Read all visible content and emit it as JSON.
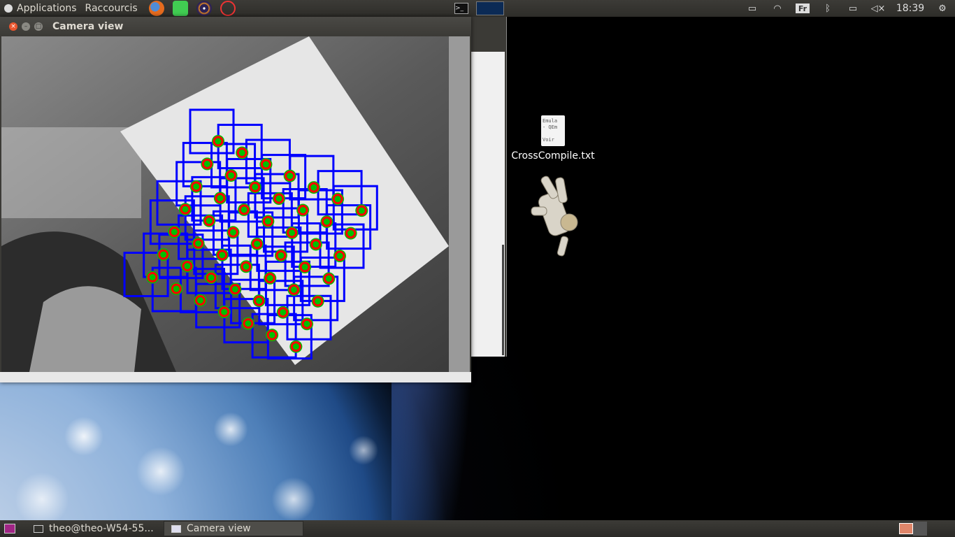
{
  "top_panel": {
    "applications_label": "Applications",
    "shortcuts_label": "Raccourcis",
    "launchers": [
      "firefox-icon",
      "qt-creator-icon",
      "eclipse-icon",
      "network-icon"
    ],
    "keyboard_layout": "Fr",
    "clock": "18:39"
  },
  "camera_window": {
    "title": "Camera view"
  },
  "desktop": {
    "file_icon_label": "CrossCompile.txt",
    "file_preview_lines": [
      "Emula",
      "- QEm",
      "",
      "Voir"
    ]
  },
  "taskbar": {
    "items": [
      {
        "label": "theo@theo-W54-55..."
      },
      {
        "label": "Camera view"
      }
    ]
  },
  "colors": {
    "panel": "#3c3b37",
    "detection_box": "#0000ff",
    "detection_point": "#ff0000",
    "detection_halo": "#00c000"
  }
}
